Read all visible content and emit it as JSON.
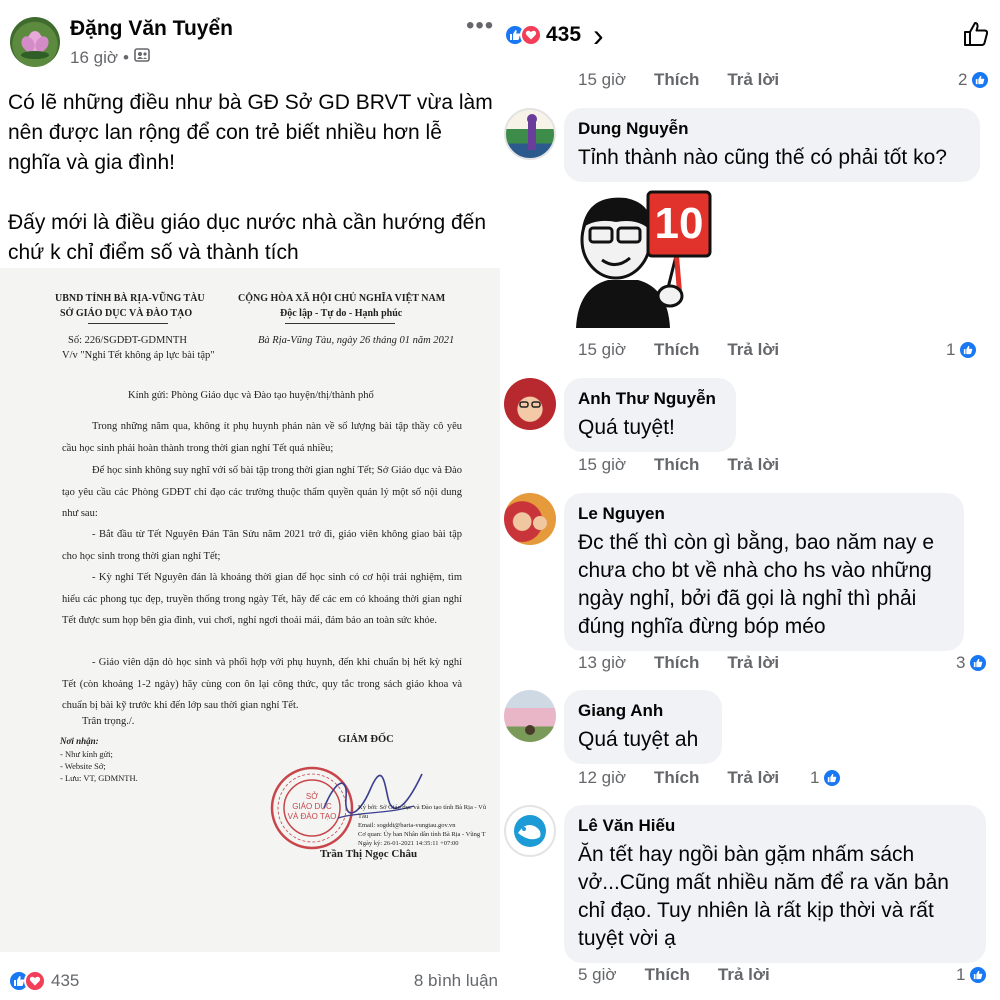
{
  "post": {
    "author": "Đặng Văn Tuyển",
    "time": "16 giờ",
    "separator": "•",
    "text": "Có lẽ những điều như bà GĐ Sở GD BRVT vừa làm nên được lan rộng để con trẻ biết nhiều hơn lễ nghĩa và gia đình!\n\nĐấy mới là điều giáo dục nước nhà cần hướng đến chứ k chỉ điểm số và thành tích",
    "reaction_count": "435",
    "comment_count": "8 bình luận"
  },
  "document": {
    "org_line1": "UBND TỈNH BÀ RỊA-VŨNG TÀU",
    "org_line2": "SỞ GIÁO DỤC VÀ ĐÀO TẠO",
    "nation_line1": "CỘNG HÒA XÃ HỘI CHỦ NGHĨA VIỆT NAM",
    "nation_line2": "Độc lập - Tự do - Hạnh phúc",
    "number": "Số: 226/SGDĐT-GDMNTH",
    "subject": "V/v \"Nghỉ Tết không áp lực bài tập\"",
    "place_date": "Bà Rịa-Vũng Tàu, ngày 26 tháng 01 năm 2021",
    "recipient": "Kính gửi: Phòng Giáo dục và Đào tạo huyện/thị/thành phố",
    "p1": "Trong những năm qua, không ít phụ huynh phản nàn về số lượng bài tập thầy cô yêu cầu học sinh phải hoàn thành trong thời gian nghỉ Tết quá nhiều;",
    "p2": "Để học sinh không suy nghĩ với số bài tập trong thời gian nghỉ Tết; Sở Giáo dục và Đào tạo yêu cầu các Phòng GDĐT chỉ đạo các trường thuộc thẩm quyền quản lý một số nội dung như sau:",
    "p3": "- Bắt đầu từ Tết Nguyên Đán Tân Sửu năm 2021 trở đi, giáo viên không giao bài tập cho học sinh trong thời gian nghỉ Tết;",
    "p4": "- Kỳ nghỉ Tết Nguyên đán là khoảng thời gian để học sinh có cơ hội trải nghiệm, tìm hiểu các phong tục đẹp, truyền thống trong ngày Tết, hãy để các em có khoảng thời gian nghỉ Tết được sum họp bên gia đình, vui chơi, nghỉ ngơi thoải mái, đảm bảo an toàn sức khỏe.",
    "p5": "- Giáo viên dặn dò học sinh và phối hợp với phụ huynh, đến khi chuẩn bị hết kỳ nghỉ Tết (còn khoảng 1-2 ngày) hãy cùng con ôn lại công thức, quy tắc trong sách giáo khoa và chuẩn bị bài kỹ trước khi đến lớp sau thời gian nghỉ Tết.",
    "closing": "Trân trọng./.",
    "recipients_title": "Nơi nhận:",
    "recipients_1": "- Như kính gửi;",
    "recipients_2": "- Website Sở;",
    "recipients_3": "- Lưu: VT, GDMNTH.",
    "signer_title": "GIÁM ĐỐC",
    "signer_name": "Trần Thị Ngọc Châu",
    "stamp_center_1": "SỞ",
    "stamp_center_2": "GIÁO DỤC",
    "stamp_center_3": "VÀ ĐÀO TẠO",
    "digital_sig_1": "Ký bởi: Sở Giáo dục và Đào tạo tỉnh Bà Rịa - Vũ",
    "digital_sig_2": "Tàu",
    "digital_sig_3": "Email: sogddt@baria-vungtau.gov.vn",
    "digital_sig_4": "Cơ quan: Ủy ban Nhân dân tỉnh Bà Rịa - Vũng T",
    "digital_sig_5": "Ngày ký: 26-01-2021 14:35:11 +07:00"
  },
  "right_header": {
    "reaction_count": "435",
    "chevron": "›"
  },
  "labels": {
    "like": "Thích",
    "reply": "Trả lời"
  },
  "top_actions": {
    "time": "15 giờ",
    "reactions": "2"
  },
  "comments": [
    {
      "name": "Dung Nguyễn",
      "text": "Tỉnh thành nào cũng thế có phải tốt ko?",
      "time": "15 giờ",
      "reactions": "1"
    },
    {
      "name": "Anh Thư Nguyễn",
      "text": "Quá tuyệt!",
      "time": "15 giờ",
      "reactions": ""
    },
    {
      "name": "Le Nguyen",
      "text": "Đc thế thì còn gì bằng, bao năm nay e\nchưa cho bt về nhà cho hs vào những\nngày nghỉ, bởi đã gọi là nghỉ thì phải\nđúng nghĩa đừng bóp méo",
      "time": "13 giờ",
      "reactions": "3"
    },
    {
      "name": "Giang Anh",
      "text": "Quá tuyệt ah",
      "time": "12 giờ",
      "reactions": "1"
    },
    {
      "name": "Lê Văn Hiếu",
      "text": "Ăn tết hay ngồi bàn gặm nhấm sách\nvở...Cũng mất nhiều năm để ra văn bản\nchỉ đạo. Tuy nhiên là rất kịp thời và rất\ntuyệt vời ạ",
      "time": "5 giờ",
      "reactions": "1"
    }
  ],
  "sticker": {
    "score": "10"
  },
  "colors": {
    "like_blue": "#1877f2",
    "love_red": "#f33e58",
    "bubble": "#f0f2f5",
    "meta_gray": "#65676b",
    "stamp_red": "#c8464b"
  },
  "icons": [
    "globe-friends-icon",
    "more-options-icon",
    "like-reaction-icon",
    "love-reaction-icon",
    "thumbs-up-outline-icon",
    "chevron-right-icon"
  ]
}
